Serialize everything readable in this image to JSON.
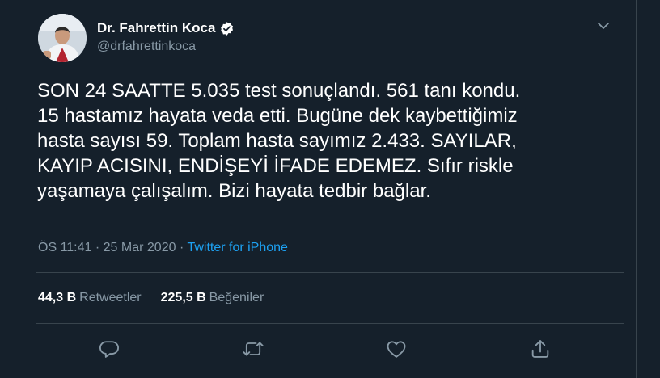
{
  "tweet": {
    "author": {
      "name": "Dr. Fahrettin Koca",
      "handle": "@drfahrettinkoca",
      "verified": true
    },
    "text": "SON 24 SAATTE 5.035 test sonuçlandı. 561 tanı kondu.\n15 hastamız hayata veda etti. Bugüne dek kaybettiğimiz\nhasta sayısı 59. Toplam hasta sayımız 2.433. SAYILAR,\nKAYIP ACISINI, ENDİŞEYİ İFADE EDEMEZ. Sıfır riskle\nyaşamaya çalışalım. Bizi hayata tedbir bağlar.",
    "time": "ÖS 11:41",
    "date": "25 Mar 2020",
    "separator": "·",
    "source": "Twitter for iPhone",
    "stats": {
      "retweets_count": "44,3 B",
      "retweets_label": "Retweetler",
      "likes_count": "225,5 B",
      "likes_label": "Beğeniler"
    }
  },
  "icons": {
    "more": "chevron-down-icon",
    "reply": "reply-icon",
    "retweet": "retweet-icon",
    "like": "heart-icon",
    "share": "share-icon",
    "verified": "verified-badge-icon"
  },
  "colors": {
    "background": "#15202b",
    "text_primary": "#ffffff",
    "text_secondary": "#8899a6",
    "accent": "#1da1f2",
    "border": "#38444d"
  }
}
